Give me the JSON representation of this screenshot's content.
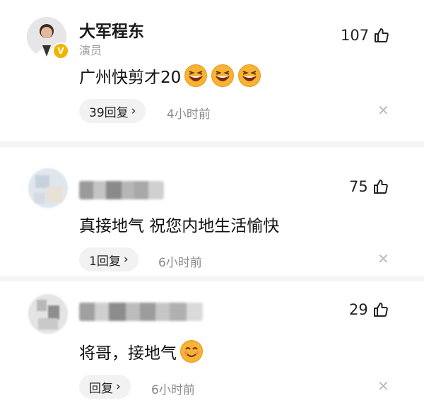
{
  "comments": [
    {
      "author": "大军程东",
      "role": "演员",
      "verified_badge": "V",
      "likes": "107",
      "text": "广州快剪才20",
      "emoji": [
        "grin-squint-icon",
        "grin-squint-icon",
        "grin-squint-icon"
      ],
      "reply_label": "39回复",
      "time": "4小时前"
    },
    {
      "author": "",
      "likes": "75",
      "text": "真接地气 祝您内地生活愉快",
      "reply_label": "1回复",
      "time": "6小时前"
    },
    {
      "author": "",
      "likes": "29",
      "text": "将哥，接地气",
      "emoji": [
        "smiling-face-icon"
      ],
      "reply_label": "回复",
      "time": "6小时前"
    }
  ],
  "icons": {
    "like": "thumbs-up-icon",
    "reply_arrow": "chevron-right-icon",
    "close": "close-icon"
  },
  "colors": {
    "verified": "#f0b400",
    "muted": "#999999",
    "reply_bg": "#f2f2f2"
  }
}
